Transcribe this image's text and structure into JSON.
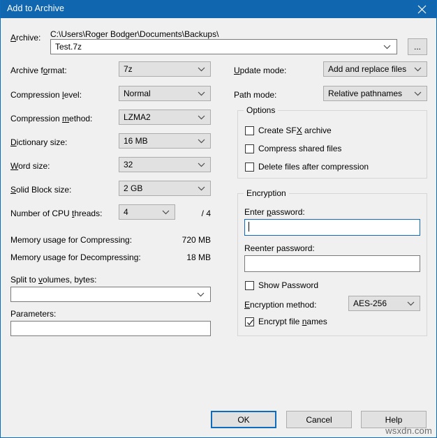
{
  "window": {
    "title": "Add to Archive",
    "close_icon": "close-icon",
    "accent_color": "#1067b0",
    "background_color": "#f0f0f0"
  },
  "archive": {
    "label": "Archive:",
    "label_prefix": "A",
    "label_rest": "rchive:",
    "path": "C:\\Users\\Roger Bodger\\Documents\\Backups\\",
    "filename": "Test.7z",
    "browse_label": "...",
    "placeholder": ""
  },
  "left_fields": [
    {
      "label_prefix": "Archive f",
      "label_underline": "o",
      "label_rest": "rmat:",
      "value": "7z"
    },
    {
      "label_prefix": "Compression ",
      "label_underline": "l",
      "label_rest": "evel:",
      "value": "Normal"
    },
    {
      "label_prefix": "Compression ",
      "label_underline": "m",
      "label_rest": "ethod:",
      "value": "LZMA2"
    },
    {
      "label_prefix": "",
      "label_underline": "D",
      "label_rest": "ictionary size:",
      "value": "16 MB"
    },
    {
      "label_prefix": "",
      "label_underline": "W",
      "label_rest": "ord size:",
      "value": "32"
    },
    {
      "label_prefix": "",
      "label_underline": "S",
      "label_rest": "olid Block size:",
      "value": "2 GB"
    }
  ],
  "cpu_threads": {
    "label_prefix": "Number of CPU ",
    "label_underline": "t",
    "label_rest": "hreads:",
    "value": "4",
    "max_label": "/ 4"
  },
  "memory": {
    "compress_label": "Memory usage for Compressing:",
    "compress_value": "720 MB",
    "decompress_label": "Memory usage for Decompressing:",
    "decompress_value": "18 MB"
  },
  "split": {
    "label_prefix": "Split to ",
    "label_underline": "v",
    "label_rest": "olumes, bytes:",
    "value": "",
    "placeholder": ""
  },
  "parameters": {
    "label": "Parameters:",
    "value": "",
    "placeholder": ""
  },
  "right_fields": [
    {
      "label_prefix": "",
      "label_underline": "U",
      "label_rest": "pdate mode:",
      "value": "Add and replace files"
    },
    {
      "label_prefix": "Path mode:",
      "label_underline": "",
      "label_rest": "",
      "value": "Relative pathnames"
    }
  ],
  "options": {
    "title": "Options",
    "items": [
      {
        "label_prefix": "Create SF",
        "label_underline": "X",
        "label_rest": " archive",
        "checked": false
      },
      {
        "label_prefix": "Compress shared files",
        "label_underline": "",
        "label_rest": "",
        "checked": false
      },
      {
        "label_prefix": "Delete files after compression",
        "label_underline": "",
        "label_rest": "",
        "checked": false
      }
    ]
  },
  "encryption": {
    "title": "Encryption",
    "enter_password_label_prefix": "Enter ",
    "enter_password_label_underline": "p",
    "enter_password_label_rest": "assword:",
    "enter_password_value": "",
    "reenter_password_label": "Reenter password:",
    "reenter_password_value": "",
    "show_password_label": "Show Password",
    "show_password_checked": false,
    "method_label_prefix": "",
    "method_label_underline": "E",
    "method_label_rest": "ncryption method:",
    "method_value": "AES-256",
    "encrypt_names_label_prefix": "Encrypt file ",
    "encrypt_names_label_underline": "n",
    "encrypt_names_label_rest": "ames",
    "encrypt_names_checked": true
  },
  "buttons": {
    "ok": "OK",
    "cancel": "Cancel",
    "help": "Help"
  },
  "watermark": "wsxdn.com"
}
